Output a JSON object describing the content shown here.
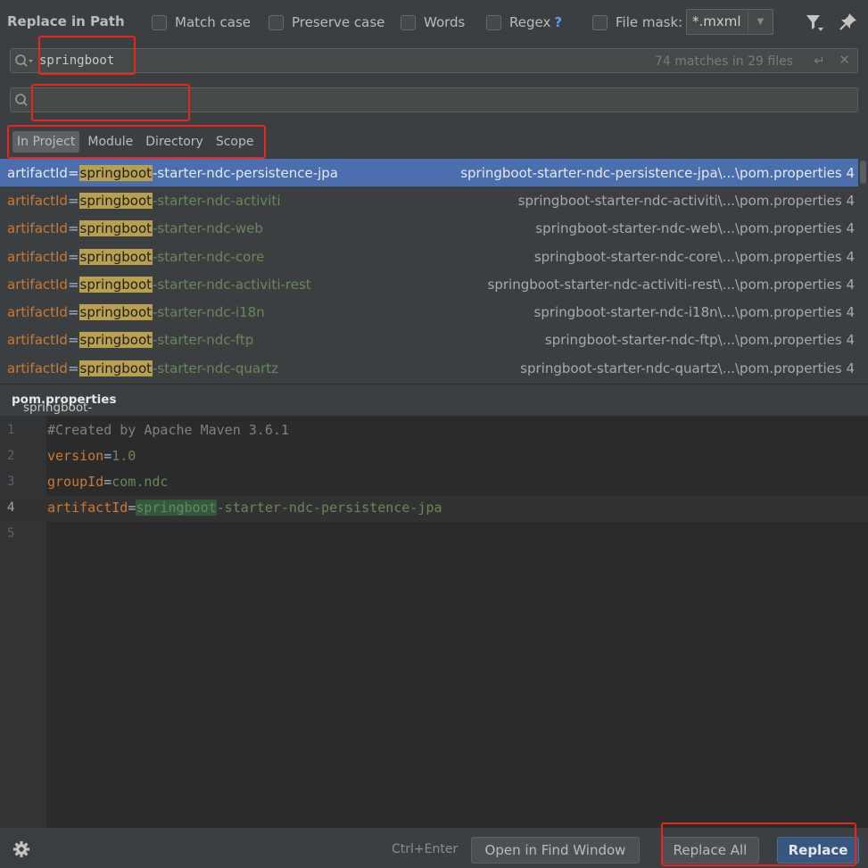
{
  "dialog": {
    "title": "Replace in Path"
  },
  "options": {
    "match_case": "Match case",
    "preserve_case": "Preserve case",
    "words": "Words",
    "regex": "Regex",
    "regex_help": "?",
    "file_mask": "File mask:",
    "file_mask_value": "*.mxml"
  },
  "find": {
    "value": "springboot",
    "matches": "74 matches in 29 files"
  },
  "replace": {
    "value": ""
  },
  "scope_tabs": [
    "In Project",
    "Module",
    "Directory",
    "Scope"
  ],
  "results": [
    {
      "key": "artifactId",
      "eq": "=",
      "match": "springboot",
      "rest": "-starter-ndc-persistence-jpa",
      "path": "springboot-starter-ndc-persistence-jpa\\...\\pom.properties 4"
    },
    {
      "key": "artifactId",
      "eq": "=",
      "match": "springboot",
      "rest": "-starter-ndc-activiti",
      "path": "springboot-starter-ndc-activiti\\...\\pom.properties 4"
    },
    {
      "key": "artifactId",
      "eq": "=",
      "match": "springboot",
      "rest": "-starter-ndc-web",
      "path": "springboot-starter-ndc-web\\...\\pom.properties 4"
    },
    {
      "key": "artifactId",
      "eq": "=",
      "match": "springboot",
      "rest": "-starter-ndc-core",
      "path": "springboot-starter-ndc-core\\...\\pom.properties 4"
    },
    {
      "key": "artifactId",
      "eq": "=",
      "match": "springboot",
      "rest": "-starter-ndc-activiti-rest",
      "path": "springboot-starter-ndc-activiti-rest\\...\\pom.properties 4"
    },
    {
      "key": "artifactId",
      "eq": "=",
      "match": "springboot",
      "rest": "-starter-ndc-i18n",
      "path": "springboot-starter-ndc-i18n\\...\\pom.properties 4"
    },
    {
      "key": "artifactId",
      "eq": "=",
      "match": "springboot",
      "rest": "-starter-ndc-ftp",
      "path": "springboot-starter-ndc-ftp\\...\\pom.properties 4"
    },
    {
      "key": "artifactId",
      "eq": "=",
      "match": "springboot",
      "rest": "-starter-ndc-quartz",
      "path": "springboot-starter-ndc-quartz\\...\\pom.properties 4"
    }
  ],
  "preview": {
    "path_prefix": "springboot-starter-ndc-persistence-jpa/target/maven-archiver/",
    "path_file": "pom.properties",
    "lines": [
      {
        "n": "1",
        "comment": "#Created by Apache Maven 3.6.1"
      },
      {
        "n": "2",
        "key": "version",
        "eq": "=",
        "value": "1.0"
      },
      {
        "n": "3",
        "key": "groupId",
        "eq": "=",
        "value": "com.ndc"
      },
      {
        "n": "4",
        "key": "artifactId",
        "eq": "=",
        "match": "springboot",
        "value": "-starter-ndc-persistence-jpa"
      },
      {
        "n": "5"
      }
    ]
  },
  "footer": {
    "shortcut_hint": "Ctrl+Enter",
    "open_find_window": "Open in Find Window",
    "replace_all": "Replace All",
    "replace": "Replace"
  },
  "colors": {
    "accent": "#4b6eaf",
    "match_highlight": "#b9a04e",
    "annotation": "#e8261d"
  }
}
